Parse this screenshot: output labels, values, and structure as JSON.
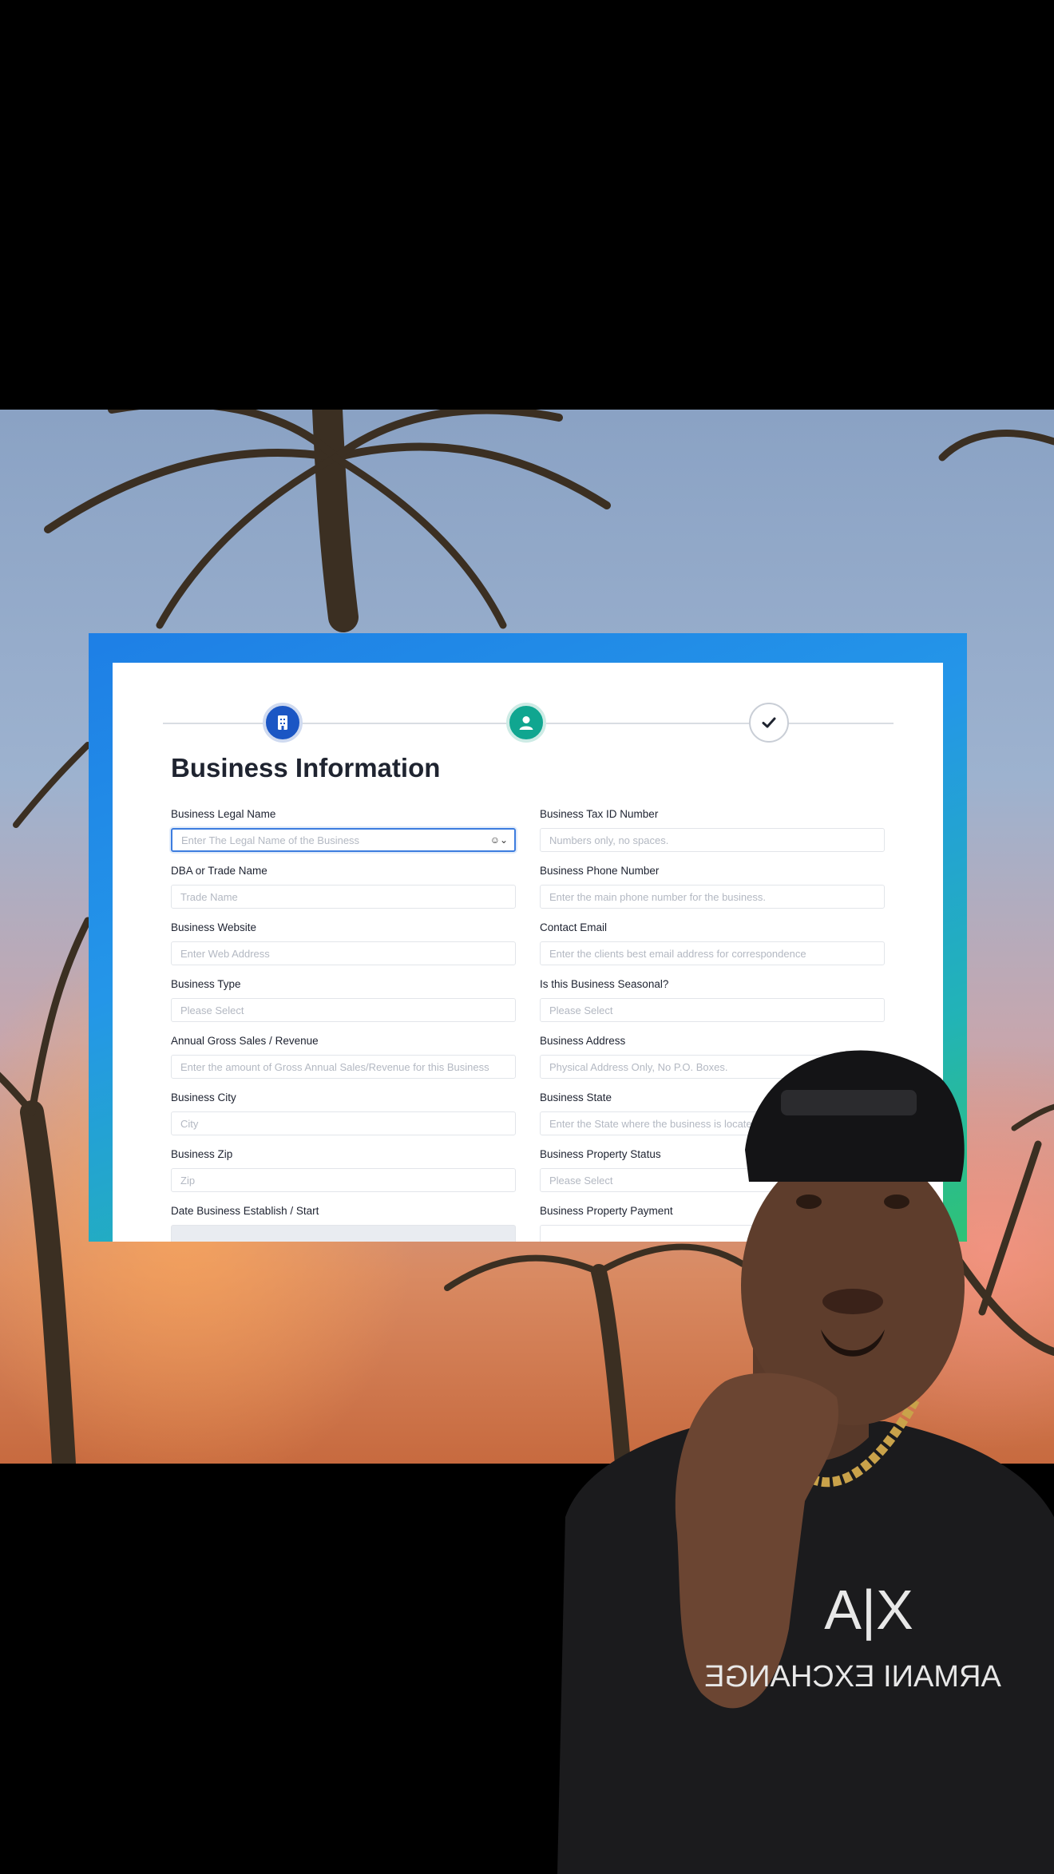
{
  "stepper": {
    "steps": [
      {
        "icon": "building-icon",
        "state": "active",
        "color": "#1b56c4"
      },
      {
        "icon": "user-icon",
        "state": "active",
        "color": "#10a690"
      },
      {
        "icon": "check-icon",
        "state": "pending",
        "color": "#ffffff"
      }
    ]
  },
  "form": {
    "title": "Business Information",
    "fields": [
      {
        "label": "Business Legal Name",
        "placeholder": "Enter The Legal Name of the Business"
      },
      {
        "label": "Business Tax ID Number",
        "placeholder": "Numbers only, no spaces."
      },
      {
        "label": "DBA or Trade Name",
        "placeholder": "Trade Name"
      },
      {
        "label": "Business Phone Number",
        "placeholder": "Enter the main phone number for the business."
      },
      {
        "label": "Business Website",
        "placeholder": "Enter Web Address"
      },
      {
        "label": "Contact Email",
        "placeholder": "Enter the clients best email address for correspondence"
      },
      {
        "label": "Business Type",
        "placeholder": "Please Select"
      },
      {
        "label": "Is this Business Seasonal?",
        "placeholder": "Please Select"
      },
      {
        "label": "Annual Gross Sales / Revenue",
        "placeholder": "Enter the amount of Gross Annual Sales/Revenue for this Business"
      },
      {
        "label": "Business Address",
        "placeholder": "Physical Address Only, No P.O. Boxes."
      },
      {
        "label": "Business City",
        "placeholder": "City"
      },
      {
        "label": "Business State",
        "placeholder": "Enter the State where the business is located"
      },
      {
        "label": "Business Zip",
        "placeholder": "Zip"
      },
      {
        "label": "Business Property Status",
        "placeholder": "Please Select"
      },
      {
        "label": "Date Business Establish / Start",
        "placeholder": ""
      },
      {
        "label": "Business Property Payment",
        "placeholder": ""
      }
    ]
  },
  "colors": {
    "accent": "#3d7ddf",
    "frame_gradient": [
      "#1e7fe6",
      "#22b3b7",
      "#2fc276"
    ]
  }
}
